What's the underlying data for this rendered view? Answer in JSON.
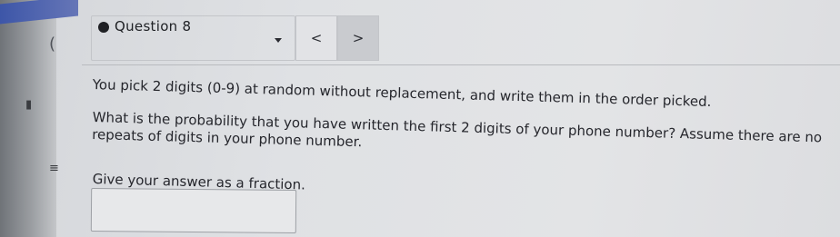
{
  "question": {
    "title": "Question 8",
    "prev_symbol": "<",
    "next_symbol": ">",
    "line1": "You pick 2 digits (0-9) at random without replacement, and write them in the order picked.",
    "line2": "What is the probability that you have written the first 2 digits of your phone number? Assume there are no repeats of digits in your phone number.",
    "line3": "Give your answer as a fraction.",
    "answer_value": ""
  },
  "colors": {
    "page_bg": "#e1e2e5",
    "text": "#25262c",
    "accent_blue": "#3d56a8"
  }
}
